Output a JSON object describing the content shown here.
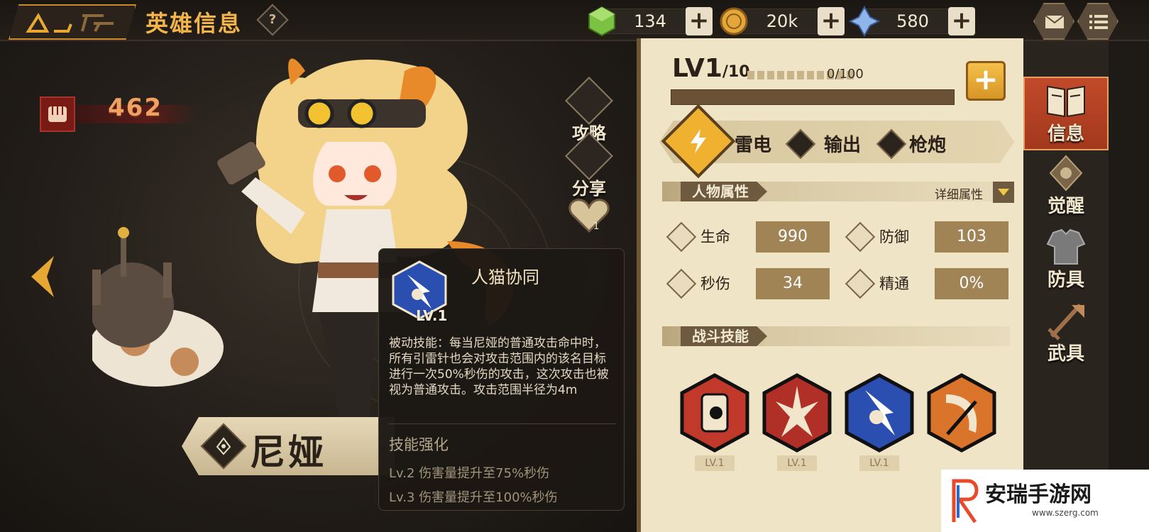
{
  "header": {
    "title": "英雄信息",
    "help_icon": "question-mark-icon"
  },
  "resources": [
    {
      "name": "green-cube",
      "value": "134",
      "color": "#7bc142"
    },
    {
      "name": "gold-coin",
      "value": "20k",
      "color": "#e4a73a"
    },
    {
      "name": "crystal",
      "value": "580",
      "color": "#8fb6e8"
    }
  ],
  "top_buttons": [
    "mail-icon",
    "menu-icon"
  ],
  "hero": {
    "name": "尼娅",
    "power": "462"
  },
  "side_actions": [
    {
      "label": "攻略",
      "icon": "guide-icon"
    },
    {
      "label": "分享",
      "icon": "share-icon"
    },
    {
      "label": "1",
      "icon": "heart-icon"
    }
  ],
  "tooltip": {
    "skill_name": "人猫协同",
    "level": "LV.1",
    "description": "被动技能：每当尼娅的普通攻击命中时，所有引雷针也会对攻击范围内的该名目标进行一次50%秒伤的攻击，这次攻击也被视为普通攻击。攻击范围半径为4m",
    "enhance_title": "技能强化",
    "enhance": [
      "Lv.2  伤害量提升至75%秒伤",
      "Lv.3  伤害量提升至100%秒伤"
    ]
  },
  "info": {
    "level": "LV1",
    "level_max": "/10",
    "exp": "0/100",
    "exp_fraction": 0,
    "tags": [
      "雷电",
      "输出",
      "枪炮"
    ],
    "attr_section": "人物属性",
    "detail_link": "详细属性",
    "stats": [
      {
        "name": "生命",
        "value": "990"
      },
      {
        "name": "防御",
        "value": "103"
      },
      {
        "name": "秒伤",
        "value": "34"
      },
      {
        "name": "精通",
        "value": "0%"
      }
    ],
    "skill_section": "战斗技能",
    "skills": [
      {
        "level": "LV.1",
        "color": "#c0392b"
      },
      {
        "level": "LV.1",
        "color": "#b03028"
      },
      {
        "level": "LV.1",
        "color": "#2b4fb0"
      },
      {
        "level": "",
        "color": "#d9742a"
      }
    ]
  },
  "tabs": [
    {
      "label": "信息",
      "active": true
    },
    {
      "label": "觉醒",
      "active": false
    },
    {
      "label": "防具",
      "active": false
    },
    {
      "label": "武具",
      "active": false
    }
  ],
  "watermark": {
    "text": "安瑞手游网",
    "url": "www.szerg.com"
  }
}
